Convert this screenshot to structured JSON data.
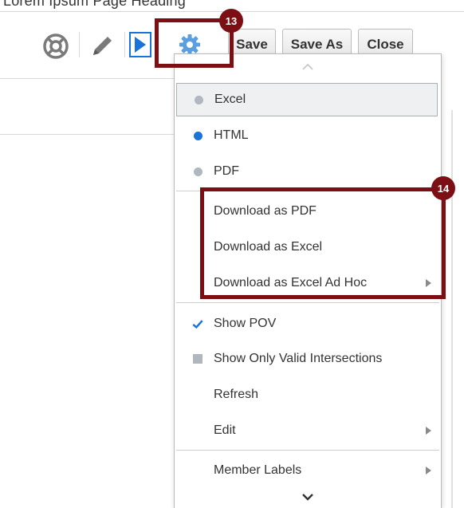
{
  "page_heading": "Lorem Ipsum Page Heading",
  "toolbar": {
    "help_icon": "lifebuoy-icon",
    "edit_icon": "pencil-icon",
    "run_icon": "play-icon",
    "settings_icon": "gear-icon",
    "save_label": "Save",
    "save_as_label": "Save As",
    "close_label": "Close"
  },
  "callouts": {
    "gear": "13",
    "download_group": "14"
  },
  "menu": {
    "scroll_up_icon": "chevron-up-icon",
    "scroll_down_icon": "chevron-down-icon",
    "format_items": [
      {
        "label": "Excel",
        "selected": false
      },
      {
        "label": "HTML",
        "selected": true
      },
      {
        "label": "PDF",
        "selected": false
      }
    ],
    "download_items": [
      {
        "label": "Download as PDF"
      },
      {
        "label": "Download as Excel"
      },
      {
        "label": "Download as Excel Ad Hoc",
        "submenu": true
      }
    ],
    "option_items": [
      {
        "label": "Show POV",
        "checked": true
      },
      {
        "label": "Show Only Valid Intersections",
        "checked": false
      },
      {
        "label": "Refresh"
      },
      {
        "label": "Edit",
        "submenu": true
      }
    ],
    "extra_items": [
      {
        "label": "Member Labels",
        "submenu": true
      }
    ]
  },
  "colors": {
    "accent_blue": "#1a73d9",
    "callout": "#7c0f14",
    "inactive_dot": "#b0b7bf"
  }
}
